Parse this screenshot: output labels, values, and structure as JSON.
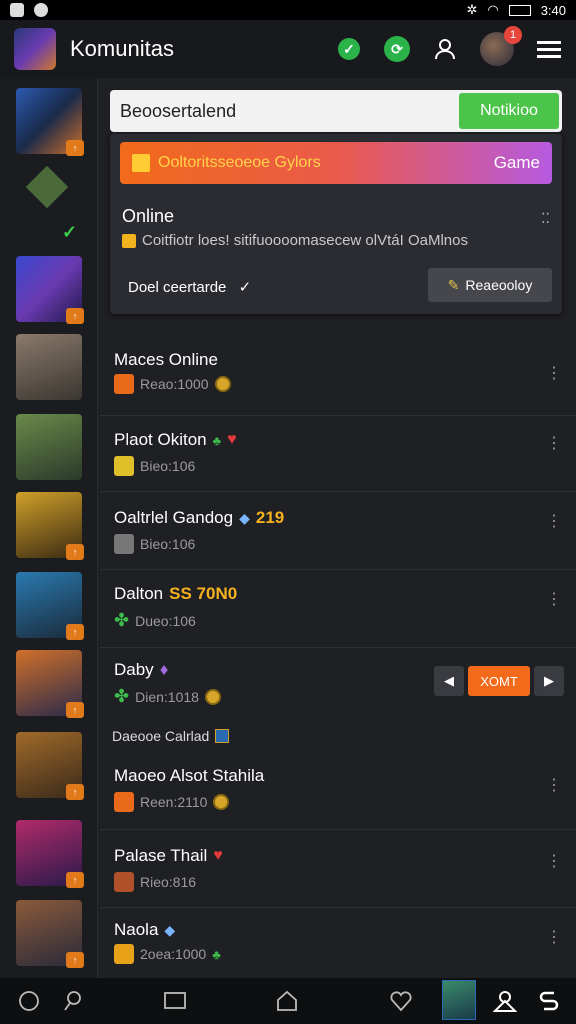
{
  "status_bar": {
    "time": "3:40"
  },
  "header": {
    "title": "Komunitas",
    "notification_count": "1"
  },
  "search": {
    "value": "Beoosertalend",
    "button_label": "Notikioo"
  },
  "panel": {
    "banner_text": "Ooltoritsseoeoe Gylors",
    "banner_cta": "Game",
    "online_title": "Online",
    "online_sub": "Coitfiotr loes! sitifuoooomasecew olVtáI OaMlnos",
    "decline_label": "Doel ceertarde",
    "confirm_label": "Reaeooloy"
  },
  "rows": [
    {
      "name": "Maces Online",
      "sub": "Reao:1000"
    },
    {
      "name": "Plaot Okiton",
      "sub": "Bieo:106"
    },
    {
      "name": "Oaltrlel Gandog",
      "badge": "219",
      "sub": "Bieo:106"
    },
    {
      "name": "Dalton",
      "badge": "SS 70N0",
      "sub": "Dueo:106"
    },
    {
      "name": "Daby",
      "sub": "Dien:1018",
      "ctrl_label": "XOMT"
    },
    {
      "name": "Maoeo Alsot Stahila",
      "header": "Daeooe Calrlad",
      "sub": "Reen:2110"
    },
    {
      "name": "Palase Thail",
      "sub": "Rieo:816"
    },
    {
      "name": "Naola",
      "sub": "2oea:1000"
    }
  ],
  "colors": {
    "accent_green": "#4cc44a",
    "accent_orange": "#f26a1a",
    "accent_purple": "#b65ae0"
  }
}
